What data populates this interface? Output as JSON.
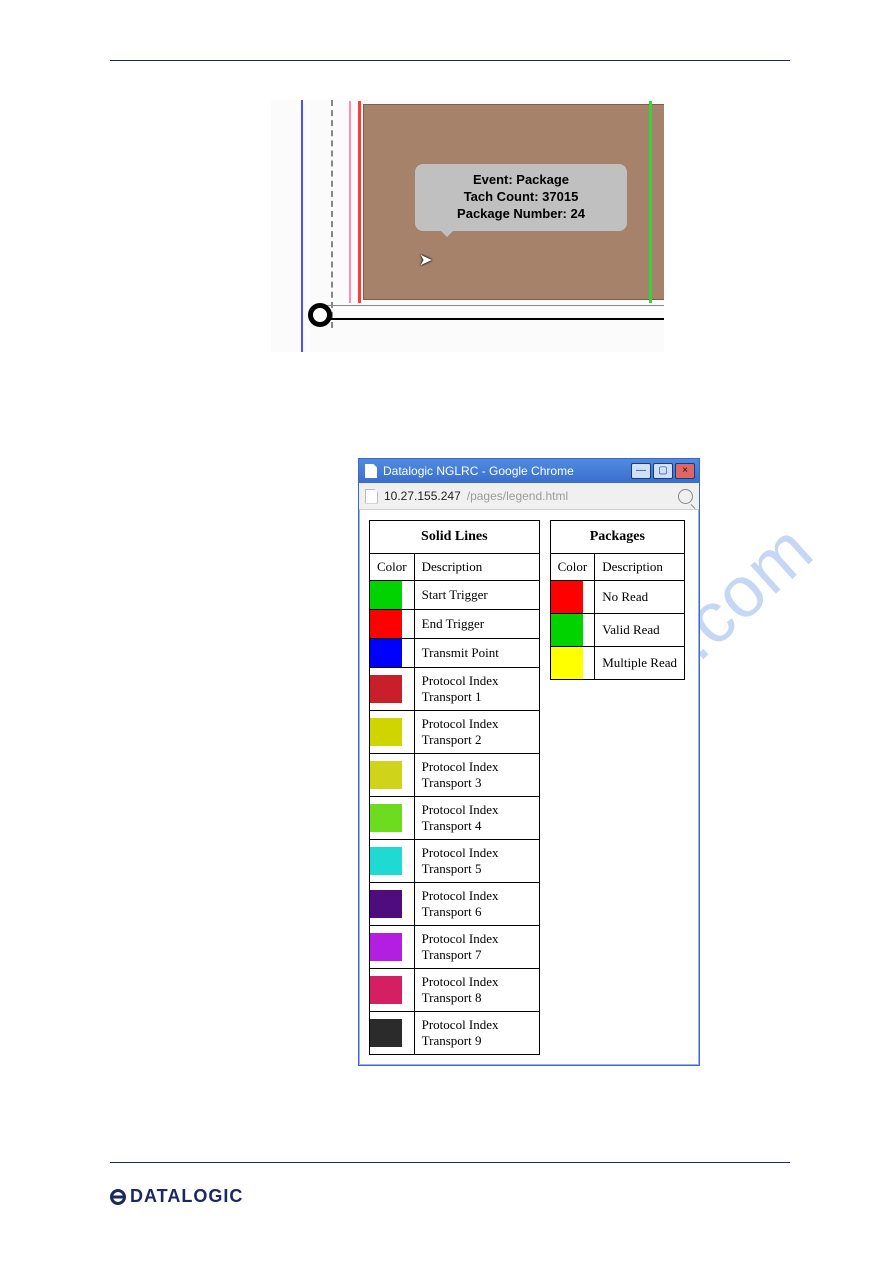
{
  "watermark": "manualshive.com",
  "figure1": {
    "tooltip": {
      "line1": "Event: Package",
      "line2": "Tach Count: 37015",
      "line3": "Package Number: 24"
    }
  },
  "chrome": {
    "title": "Datalogic NGLRC - Google Chrome",
    "host": "10.27.155.247",
    "path": "/pages/legend.html",
    "win_buttons": {
      "minimize": "—",
      "maximize": "▢",
      "close": "×"
    }
  },
  "legend": {
    "lines": {
      "title": "Solid Lines",
      "col_color": "Color",
      "col_desc": "Description",
      "rows": [
        {
          "color": "#00d300",
          "desc": "Start Trigger"
        },
        {
          "color": "#ff0000",
          "desc": "End Trigger"
        },
        {
          "color": "#0000ff",
          "desc": "Transmit Point"
        },
        {
          "color": "#c81f2b",
          "desc": "Protocol Index Transport 1"
        },
        {
          "color": "#d0d500",
          "desc": "Protocol Index Transport 2"
        },
        {
          "color": "#cfd41a",
          "desc": "Protocol Index Transport 3"
        },
        {
          "color": "#6edc1e",
          "desc": "Protocol Index Transport 4"
        },
        {
          "color": "#1fd9d3",
          "desc": "Protocol Index Transport 5"
        },
        {
          "color": "#4e0c7d",
          "desc": "Protocol Index Transport 6"
        },
        {
          "color": "#b21fe0",
          "desc": "Protocol Index Transport 7"
        },
        {
          "color": "#d41f63",
          "desc": "Protocol Index Transport 8"
        },
        {
          "color": "#2b2b2b",
          "desc": "Protocol Index Transport 9"
        }
      ]
    },
    "packages": {
      "title": "Packages",
      "col_color": "Color",
      "col_desc": "Description",
      "rows": [
        {
          "color": "#ff0000",
          "desc": "No Read"
        },
        {
          "color": "#00d300",
          "desc": "Valid Read"
        },
        {
          "color": "#ffff00",
          "desc": "Multiple Read"
        }
      ]
    }
  },
  "footer": {
    "brand": "DATALOGIC"
  }
}
